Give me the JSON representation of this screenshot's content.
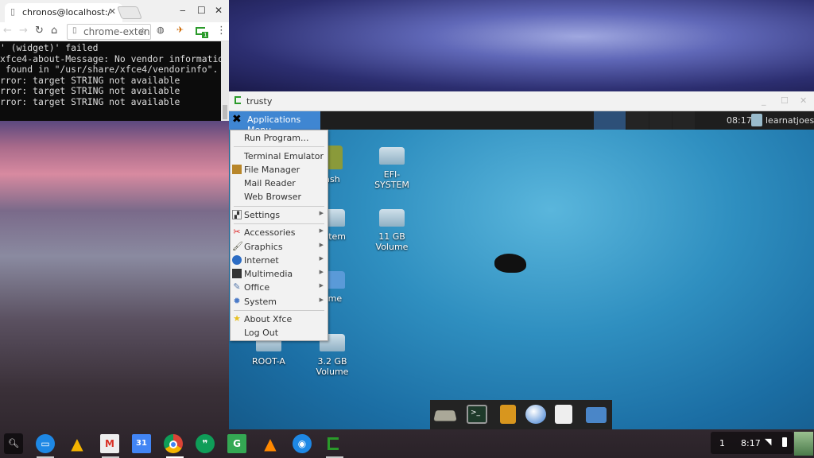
{
  "chrome": {
    "tab_title": "chronos@localhost:/",
    "omnibox": "chrome-exten",
    "extension_badge": "1"
  },
  "terminal": {
    "lines": [
      "' (widget)' failed",
      "xfce4-about-Message: No vendor informatio",
      " found in \"/usr/share/xfce4/vendorinfo\".",
      "rror: target STRING not available",
      "rror: target STRING not available",
      "rror: target STRING not available"
    ]
  },
  "trusty": {
    "title": "trusty",
    "panel": {
      "apps_menu": "Applications Menu",
      "clock": "08:17",
      "user": "learnatjoes"
    }
  },
  "menu": {
    "items": [
      {
        "label": "Run Program...",
        "icon": ""
      },
      {
        "label": "Terminal Emulator",
        "icon": ""
      },
      {
        "label": "File Manager",
        "icon": "file-cabinet-icon"
      },
      {
        "label": "Mail Reader",
        "icon": ""
      },
      {
        "label": "Web Browser",
        "icon": ""
      },
      {
        "label": "Settings",
        "icon": "settings-icon",
        "submenu": true
      },
      {
        "label": "Accessories",
        "icon": "accessories-icon",
        "submenu": true
      },
      {
        "label": "Graphics",
        "icon": "brush-icon",
        "submenu": true
      },
      {
        "label": "Internet",
        "icon": "globe-icon",
        "submenu": true
      },
      {
        "label": "Multimedia",
        "icon": "clapper-icon",
        "submenu": true
      },
      {
        "label": "Office",
        "icon": "office-icon",
        "submenu": true
      },
      {
        "label": "System",
        "icon": "gear-icon",
        "submenu": true
      },
      {
        "label": "About Xfce",
        "icon": "star-icon"
      },
      {
        "label": "Log Out",
        "icon": ""
      }
    ]
  },
  "desktop": {
    "icons": [
      "ash",
      "EFI-SYSTEM",
      "ystem",
      "11 GB Volume",
      "ome",
      "ROOT-A",
      "3.2 GB Volume"
    ]
  },
  "shelf": {
    "status_count": "1",
    "time": "8:17",
    "accent": "#3f86d2"
  }
}
